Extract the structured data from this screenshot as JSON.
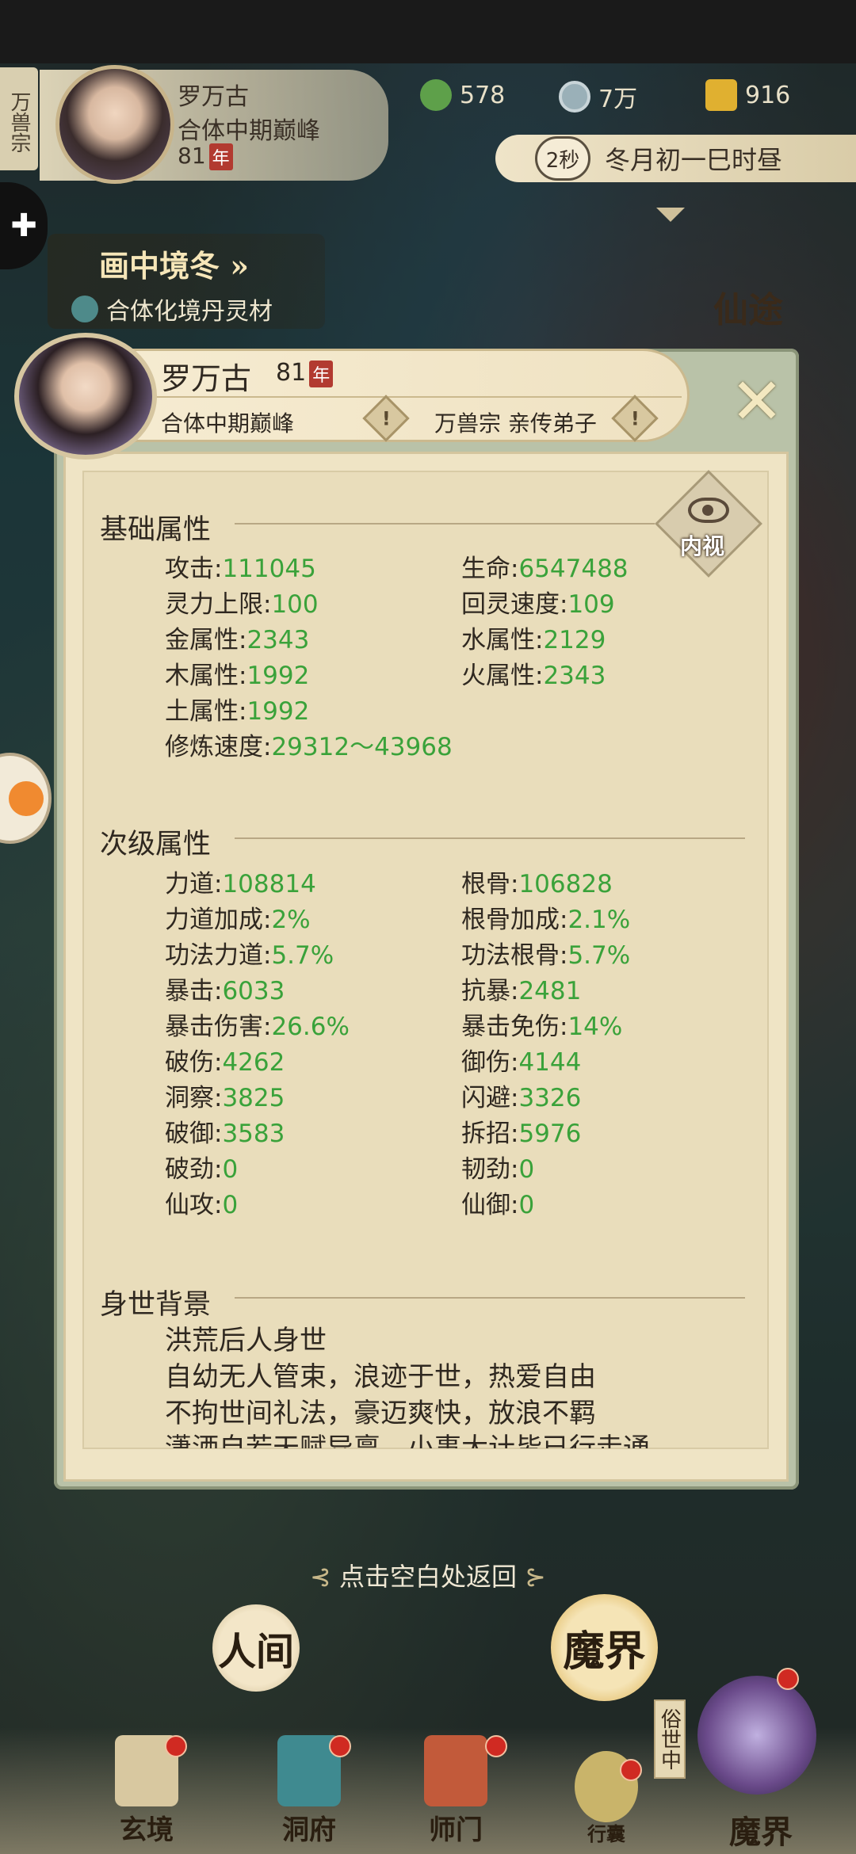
{
  "header": {
    "sect_tag": "万兽宗",
    "name": "罗万古",
    "realm": "合体中期巅峰",
    "age": "81",
    "year_unit": "年",
    "resources": [
      {
        "icon": "jade-leaf-icon",
        "value": "578",
        "color": "#5ea04a"
      },
      {
        "icon": "coin-icon",
        "value": "7万",
        "color": "#9ab0b8"
      },
      {
        "icon": "gold-ingot-icon",
        "value": "916",
        "color": "#e0b030"
      }
    ],
    "timer_seconds": "2秒",
    "calendar": "冬月初一巳时昼"
  },
  "scene": {
    "title": "画中境冬",
    "title_arrow": "»",
    "subtitle": "合体化境丹灵材",
    "side_label": "仙途"
  },
  "profile": {
    "name": "罗万古",
    "age": "81",
    "year_unit": "年",
    "realm": "合体中期巅峰",
    "sect_role": "万兽宗 亲传弟子",
    "inspect_label": "内视",
    "close_symbol": "✕",
    "warn_symbol": "!"
  },
  "basic": {
    "title": "基础属性",
    "left": [
      {
        "label": "攻击:",
        "value": "111045"
      },
      {
        "label": "灵力上限:",
        "value": "100"
      },
      {
        "label": "金属性:",
        "value": "2343"
      },
      {
        "label": "木属性:",
        "value": "1992"
      },
      {
        "label": "土属性:",
        "value": "1992"
      },
      {
        "label": "修炼速度:",
        "value": "29312～43968"
      }
    ],
    "right": [
      {
        "label": "生命:",
        "value": "6547488"
      },
      {
        "label": "回灵速度:",
        "value": "109"
      },
      {
        "label": "水属性:",
        "value": "2129"
      },
      {
        "label": "火属性:",
        "value": "2343"
      }
    ]
  },
  "secondary": {
    "title": "次级属性",
    "left": [
      {
        "label": "力道:",
        "value": "108814"
      },
      {
        "label": "力道加成:",
        "value": "2%"
      },
      {
        "label": "功法力道:",
        "value": "5.7%"
      },
      {
        "label": "暴击:",
        "value": "6033"
      },
      {
        "label": "暴击伤害:",
        "value": "26.6%"
      },
      {
        "label": "破伤:",
        "value": "4262"
      },
      {
        "label": "洞察:",
        "value": "3825"
      },
      {
        "label": "破御:",
        "value": "3583"
      },
      {
        "label": "破劲:",
        "value": "0"
      },
      {
        "label": "仙攻:",
        "value": "0"
      }
    ],
    "right": [
      {
        "label": "根骨:",
        "value": "106828"
      },
      {
        "label": "根骨加成:",
        "value": "2.1%"
      },
      {
        "label": "功法根骨:",
        "value": "5.7%"
      },
      {
        "label": "抗暴:",
        "value": "2481"
      },
      {
        "label": "暴击免伤:",
        "value": "14%"
      },
      {
        "label": "御伤:",
        "value": "4144"
      },
      {
        "label": "闪避:",
        "value": "3326"
      },
      {
        "label": "拆招:",
        "value": "5976"
      },
      {
        "label": "韧劲:",
        "value": "0"
      },
      {
        "label": "仙御:",
        "value": "0"
      }
    ]
  },
  "background": {
    "title": "身世背景",
    "lines": [
      "洪荒后人身世",
      "自幼无人管束，浪迹于世，热爱自由",
      "不拘世间礼法，豪迈爽快，放浪不羁"
    ],
    "cut_line": "潇洒自若天赋异禀，小事大计皆已行走通"
  },
  "hint": {
    "return": "点击空白处返回",
    "ornament_left": "⊰",
    "ornament_right": "⊱"
  },
  "worlds": {
    "human": "人间",
    "demon": "魔界",
    "mortal_tag": "俗世中"
  },
  "nav": [
    {
      "label": "玄境",
      "icon": "scroll-icon",
      "dot": true
    },
    {
      "label": "洞府",
      "icon": "pavilion-icon",
      "dot": true
    },
    {
      "label": "师门",
      "icon": "banner-icon",
      "dot": true
    },
    {
      "label": "行囊",
      "icon": "bag-icon",
      "dot": true
    },
    {
      "label": "魔界",
      "icon": "demon-avatar-icon",
      "dot": true
    }
  ],
  "colors": {
    "value_green": "#3aa23a",
    "panel_bg": "#e9ddbb",
    "badge_red": "#b23a30"
  }
}
